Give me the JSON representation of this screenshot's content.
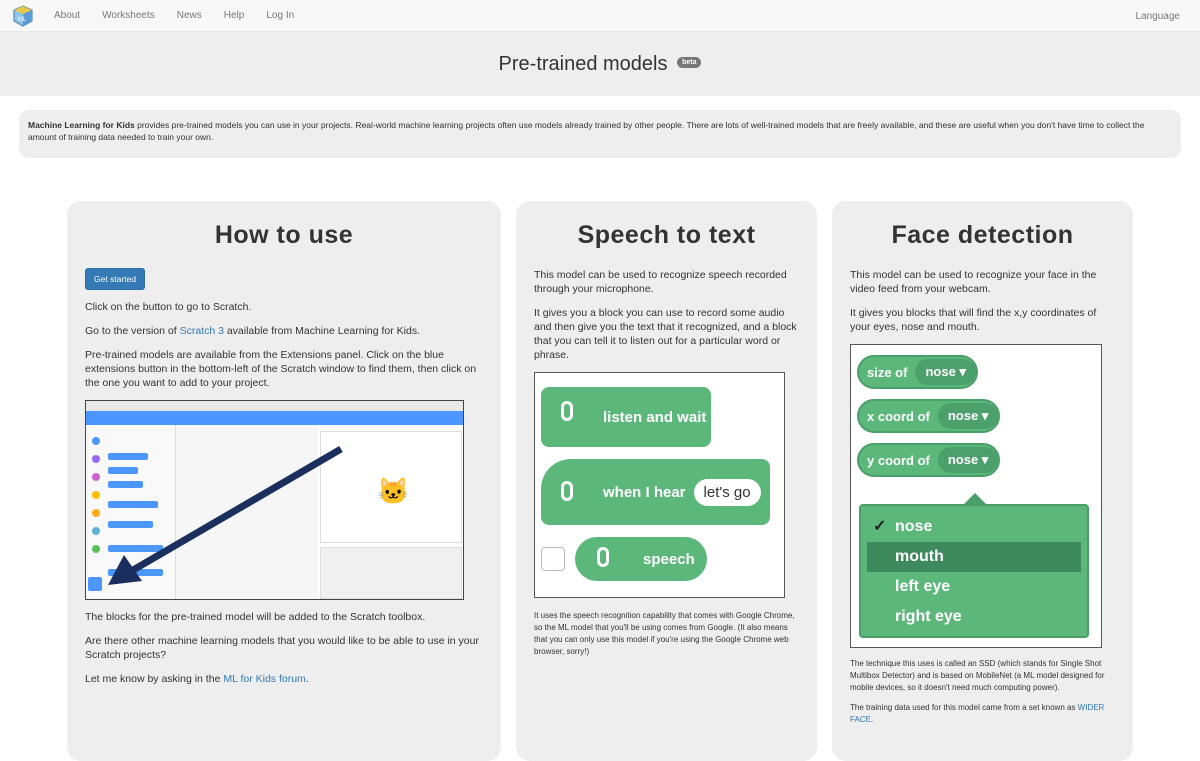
{
  "nav": {
    "items": [
      "About",
      "Worksheets",
      "News",
      "Help",
      "Log In"
    ],
    "language": "Language"
  },
  "hero": {
    "title": "Pre-trained models",
    "badge": "beta"
  },
  "intro": {
    "bold": "Machine Learning for Kids",
    "text": " provides pre-trained models you can use in your projects. Real-world machine learning projects often use models already trained by other people. There are lots of well-trained models that are freely available, and these are useful when you don't have time to collect the amount of training data needed to train your own."
  },
  "how": {
    "title": "How to use",
    "button": "Get started",
    "p1": "Click on the button to go to Scratch.",
    "p2_before": "Go to the version of ",
    "p2_link": "Scratch 3",
    "p2_after": " available from Machine Learning for Kids.",
    "p3": "Pre-trained models are available from the Extensions panel. Click on the blue extensions button in the bottom-left of the Scratch window to find them, then click on the one you want to add to your project.",
    "p4": "The blocks for the pre-trained model will be added to the Scratch toolbox.",
    "p5": "Are there other machine learning models that you would like to be able to use in your Scratch projects?",
    "p6_before": "Let me know by asking in the ",
    "p6_link": "ML for Kids forum",
    "p6_after": "."
  },
  "speech": {
    "title": "Speech to text",
    "p1": "This model can be used to recognize speech recorded through your microphone.",
    "p2": "It gives you a block you can use to record some audio and then give you the text that it recognized, and a block that you can tell it to listen out for a particular word or phrase.",
    "block1": "listen and wait",
    "block2": "when I hear",
    "block2_value": "let's go",
    "block3": "speech",
    "note": "It uses the speech recognition capability that comes with Google Chrome, so the ML model that you'll be using comes from Google. (It also means that you can only use this model if you're using the Google Chrome web browser, sorry!)"
  },
  "face": {
    "title": "Face detection",
    "p1": "This model can be used to recognize your face in the video feed from your webcam.",
    "p2": "It gives you blocks that will find the x,y coordinates of your eyes, nose and mouth.",
    "blocks": [
      "size of",
      "x coord of",
      "y coord of"
    ],
    "dropdown_value": "nose",
    "menu": [
      "nose",
      "mouth",
      "left eye",
      "right eye"
    ],
    "check": "✓",
    "note1": "The technique this uses is called an SSD (which stands for Single Shot Multibox Detector) and is based on MobileNet (a ML model designed for mobile devices, so it doesn't need much computing power).",
    "note2_before": "The training data used for this model came from a set known as ",
    "note2_link": "WIDER FACE",
    "note2_after": "."
  },
  "colors": {
    "scratch_green": "#5cb87a",
    "link_blue": "#337ab7",
    "panel_gray": "#eeeeee"
  }
}
